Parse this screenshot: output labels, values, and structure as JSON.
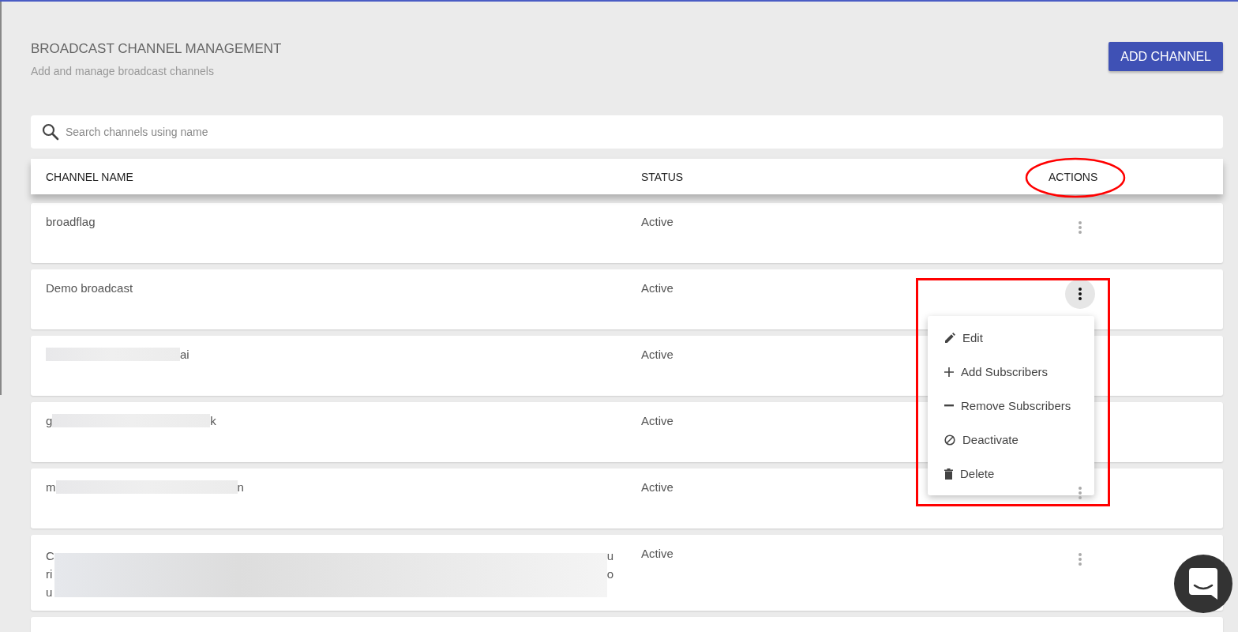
{
  "header": {
    "title": "BROADCAST CHANNEL MANAGEMENT",
    "subtitle": "Add and manage broadcast channels",
    "add_button": "ADD CHANNEL"
  },
  "search": {
    "placeholder": "Search channels using name"
  },
  "table": {
    "columns": [
      "CHANNEL NAME",
      "STATUS",
      "ACTIONS"
    ],
    "rows": [
      {
        "name_segments": [
          {
            "kind": "text",
            "text": "broadflag"
          }
        ],
        "status": "Active",
        "menu_open": false
      },
      {
        "name_segments": [
          {
            "kind": "text",
            "text": "Demo broadcast"
          }
        ],
        "status": "Active",
        "menu_open": true
      },
      {
        "name_segments": [
          {
            "kind": "redacted"
          },
          {
            "kind": "text",
            "text": "ai"
          }
        ],
        "status": "Active",
        "menu_open": false
      },
      {
        "name_segments": [
          {
            "kind": "text",
            "text": "g"
          },
          {
            "kind": "redacted"
          },
          {
            "kind": "text",
            "text": "k"
          }
        ],
        "status": "Active",
        "menu_open": false
      },
      {
        "name_segments": [
          {
            "kind": "text",
            "text": "m"
          },
          {
            "kind": "redacted"
          },
          {
            "kind": "text",
            "text": "n"
          }
        ],
        "status": "Active",
        "menu_open": false
      },
      {
        "name_segments": [
          {
            "kind": "block",
            "left": [
              "C",
              "ri",
              "u"
            ],
            "right": [
              "u",
              "o"
            ]
          }
        ],
        "status": "Active",
        "menu_open": false
      }
    ]
  },
  "row_menu": {
    "items": [
      {
        "kind": "edit",
        "label": "Edit"
      },
      {
        "kind": "add",
        "label": "Add Subscribers"
      },
      {
        "kind": "remove",
        "label": "Remove Subscribers"
      },
      {
        "kind": "deactivate",
        "label": "Deactivate"
      },
      {
        "kind": "delete",
        "label": "Delete"
      }
    ]
  },
  "annotations": {
    "actions_circled": true,
    "menu_framed": true
  }
}
